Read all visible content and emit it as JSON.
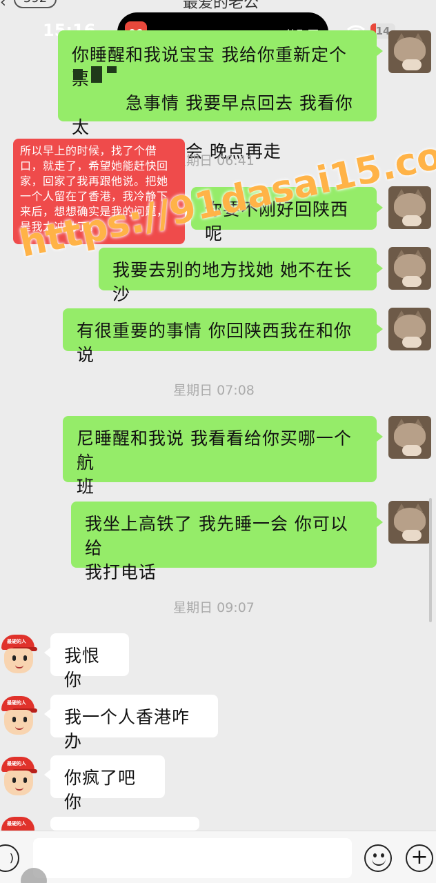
{
  "nav": {
    "count": "592",
    "title": "最爱的老公"
  },
  "status_bar": {
    "time": "15:16",
    "island_text": "待取票",
    "battery": "14"
  },
  "annotation": {
    "text": "所以早上的时候，找了个借口，就走了，希望她能赶快回家，回家了我再跟他说。把她一个人留在了香港，我冷静下来后，想想确实是我的问题，是我太冲动了。"
  },
  "watermark": "https://91dasai15.com",
  "messages": [
    {
      "type": "sent",
      "lines": [
        "你睡醒和我说宝宝 我给你重新定个票",
        "　　　急事情 我要早点回去 我看你太",
        "累了 你多睡一会 晚点再走"
      ]
    },
    {
      "type": "timestamp",
      "text": "星期日 06:41"
    },
    {
      "type": "sent",
      "lines": [
        "你要不刚好回陕西呢"
      ]
    },
    {
      "type": "sent",
      "lines": [
        "我要去别的地方找她 她不在长沙"
      ]
    },
    {
      "type": "sent",
      "lines": [
        "有很重要的事情 你回陕西我在和你说"
      ]
    },
    {
      "type": "timestamp",
      "text": "星期日 07:08"
    },
    {
      "type": "sent",
      "lines": [
        "尼睡醒和我说 我看看给你买哪一个航",
        "班"
      ]
    },
    {
      "type": "sent",
      "lines": [
        "我坐上高铁了 我先睡一会  你可以给",
        "我打电话"
      ]
    },
    {
      "type": "timestamp",
      "text": "星期日 09:07"
    },
    {
      "type": "received",
      "lines": [
        "我恨你"
      ]
    },
    {
      "type": "received",
      "lines": [
        "我一个人香港咋办"
      ]
    },
    {
      "type": "received",
      "lines": [
        "你疯了吧你"
      ]
    }
  ],
  "avatar_cap_text": "最硬的人",
  "input": {
    "placeholder": ""
  },
  "colors": {
    "sent_bubble": "#95ec69",
    "received_bubble": "#ffffff",
    "annotation": "#ef4b4b",
    "watermark": "#ffb347"
  }
}
